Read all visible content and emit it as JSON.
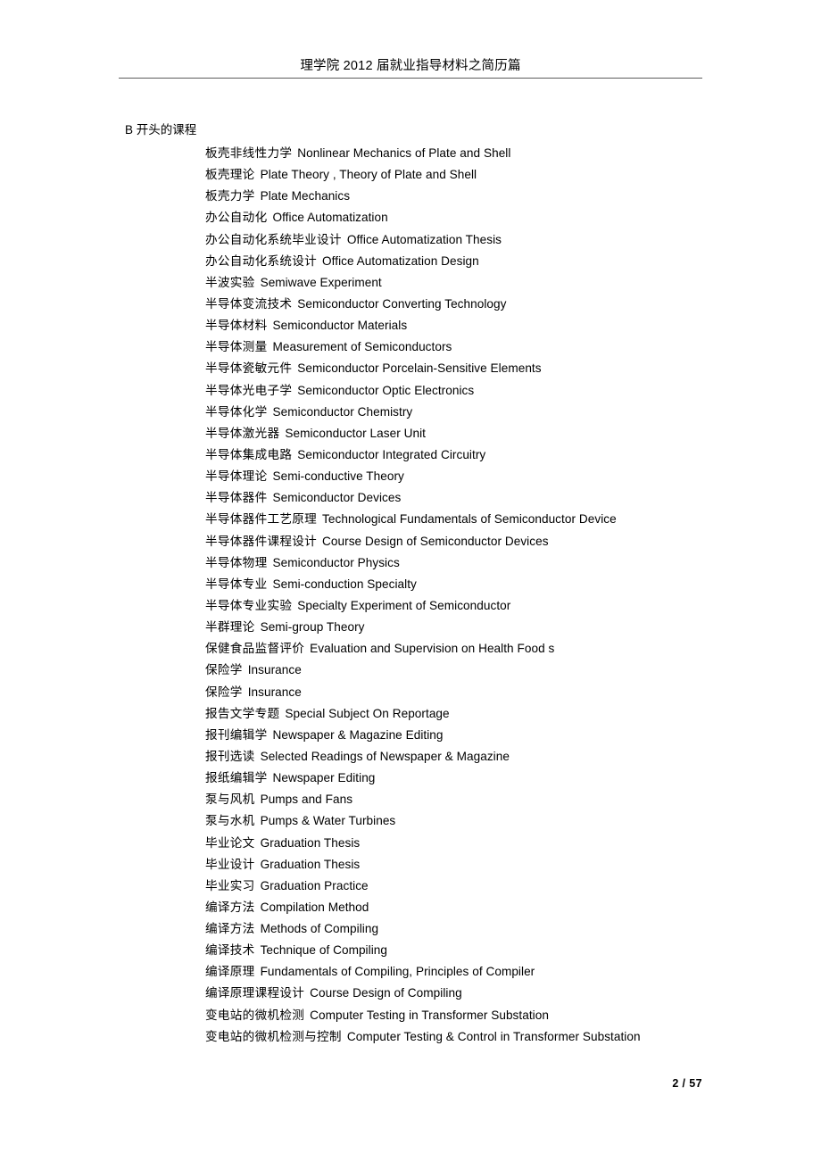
{
  "header": {
    "title": "理学院 2012 届就业指导材料之简历篇"
  },
  "section": {
    "heading": "B 开头的课程"
  },
  "footer": {
    "page_number": "2 / 57"
  },
  "courses": [
    {
      "cn": "板壳非线性力学",
      "en": "Nonlinear Mechanics of Plate and Shell"
    },
    {
      "cn": "板壳理论",
      "en": "Plate Theory , Theory of Plate and Shell"
    },
    {
      "cn": "板壳力学",
      "en": "Plate Mechanics"
    },
    {
      "cn": "办公自动化",
      "en": "Office Automatization"
    },
    {
      "cn": "办公自动化系统毕业设计",
      "en": "Office Automatization Thesis"
    },
    {
      "cn": "办公自动化系统设计",
      "en": "Office Automatization Design"
    },
    {
      "cn": "半波实验",
      "en": "Semiwave Experiment"
    },
    {
      "cn": "半导体变流技术",
      "en": "Semiconductor Converting Technology"
    },
    {
      "cn": "半导体材料",
      "en": "Semiconductor Materials"
    },
    {
      "cn": "半导体测量",
      "en": "Measurement of Semiconductors"
    },
    {
      "cn": "半导体瓷敏元件",
      "en": "Semiconductor Porcelain-Sensitive Elements"
    },
    {
      "cn": "半导体光电子学",
      "en": "Semiconductor Optic Electronics"
    },
    {
      "cn": "半导体化学",
      "en": "Semiconductor Chemistry"
    },
    {
      "cn": "半导体激光器",
      "en": "Semiconductor Laser Unit"
    },
    {
      "cn": "半导体集成电路",
      "en": "Semiconductor Integrated Circuitry"
    },
    {
      "cn": "半导体理论",
      "en": "Semi-conductive Theory"
    },
    {
      "cn": "半导体器件",
      "en": "Semiconductor Devices"
    },
    {
      "cn": "半导体器件工艺原理",
      "en": "Technological Fundamentals of Semiconductor Device"
    },
    {
      "cn": "半导体器件课程设计",
      "en": "Course Design of Semiconductor Devices"
    },
    {
      "cn": "半导体物理",
      "en": "Semiconductor Physics"
    },
    {
      "cn": "半导体专业",
      "en": "Semi-conduction Specialty"
    },
    {
      "cn": "半导体专业实验",
      "en": "Specialty Experiment of Semiconductor"
    },
    {
      "cn": "半群理论",
      "en": "Semi-group Theory"
    },
    {
      "cn": "保健食品监督评价",
      "en": "Evaluation and Supervision on Health Food s"
    },
    {
      "cn": "保险学",
      "en": "Insurance"
    },
    {
      "cn": "保险学",
      "en": "Insurance"
    },
    {
      "cn": "报告文学专题",
      "en": "Special Subject On Reportage"
    },
    {
      "cn": "报刊编辑学",
      "en": "Newspaper & Magazine Editing"
    },
    {
      "cn": "报刊选读",
      "en": "Selected Readings of Newspaper & Magazine"
    },
    {
      "cn": "报纸编辑学",
      "en": "Newspaper Editing"
    },
    {
      "cn": "泵与风机",
      "en": "Pumps and Fans"
    },
    {
      "cn": "泵与水机",
      "en": "Pumps & Water Turbines"
    },
    {
      "cn": "毕业论文",
      "en": "Graduation Thesis"
    },
    {
      "cn": "毕业设计",
      "en": "Graduation Thesis"
    },
    {
      "cn": "毕业实习",
      "en": "Graduation Practice"
    },
    {
      "cn": "编译方法",
      "en": "Compilation Method"
    },
    {
      "cn": "编译方法",
      "en": "Methods of Compiling"
    },
    {
      "cn": "编译技术",
      "en": "Technique of Compiling"
    },
    {
      "cn": "编译原理",
      "en": "Fundamentals of Compiling, Principles of Compiler"
    },
    {
      "cn": "编译原理课程设计",
      "en": "Course Design of Compiling"
    },
    {
      "cn": "变电站的微机检测",
      "en": "Computer Testing in Transformer Substation"
    },
    {
      "cn": "变电站的微机检测与控制",
      "en": "Computer Testing & Control in Transformer Substation"
    }
  ]
}
